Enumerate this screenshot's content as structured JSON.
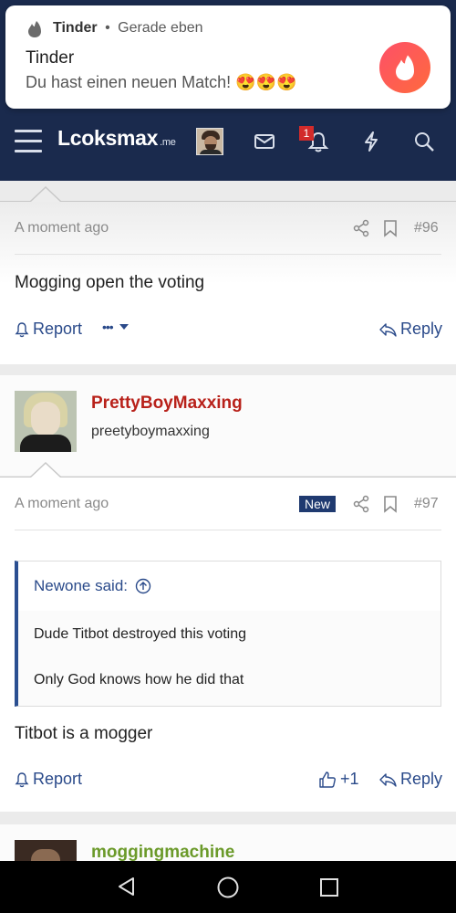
{
  "notification": {
    "app": "Tinder",
    "separator": "•",
    "time": "Gerade eben",
    "title": "Tinder",
    "body": "Du hast einen neuen Match! 😍😍😍",
    "accent": "#fd5068"
  },
  "header": {
    "logo_main": "Lcoksmax",
    "logo_sub": ".me",
    "alerts_count": "1",
    "background": "#1a2a4d",
    "icons": [
      "menu-icon",
      "avatar",
      "envelope-icon",
      "bell-icon",
      "lightning-icon",
      "search-icon"
    ]
  },
  "post96": {
    "time": "A moment ago",
    "number": "#96",
    "text": "Mogging open the voting",
    "report": "Report",
    "more": "•••",
    "reply": "Reply"
  },
  "post97": {
    "username": "PrettyBoyMaxxing",
    "user_title": "preetyboymaxxing",
    "time": "A moment ago",
    "new_badge": "New",
    "number": "#97",
    "quote_author": "Newone said:",
    "quote_lines": [
      "Dude Titbot destroyed this voting",
      "Only God knows how he did that"
    ],
    "text": "Titbot is a mogger",
    "report": "Report",
    "like_count": "+1",
    "reply": "Reply"
  },
  "post98": {
    "username": "moggingmachine",
    "username_color": "#6b9a2a"
  }
}
